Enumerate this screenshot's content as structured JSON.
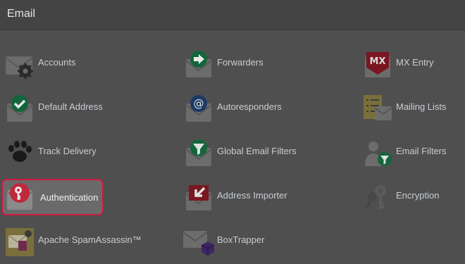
{
  "panel": {
    "title": "Email"
  },
  "items": [
    {
      "label": "Accounts",
      "icon": "envelope-gear-icon"
    },
    {
      "label": "Forwarders",
      "icon": "envelope-arrow-icon"
    },
    {
      "label": "MX Entry",
      "icon": "mx-envelope-icon"
    },
    {
      "label": "Default Address",
      "icon": "envelope-check-icon"
    },
    {
      "label": "Autoresponders",
      "icon": "envelope-at-icon"
    },
    {
      "label": "Mailing Lists",
      "icon": "mailing-list-icon"
    },
    {
      "label": "Track Delivery",
      "icon": "paw-icon"
    },
    {
      "label": "Global Email Filters",
      "icon": "envelope-funnel-icon"
    },
    {
      "label": "Email Filters",
      "icon": "person-funnel-icon"
    },
    {
      "label": "Authentication",
      "icon": "envelope-key-icon",
      "selected": true
    },
    {
      "label": "Address Importer",
      "icon": "envelope-import-icon"
    },
    {
      "label": "Encryption",
      "icon": "keys-icon"
    },
    {
      "label": "Apache SpamAssassin™",
      "icon": "spamassassin-icon"
    },
    {
      "label": "BoxTrapper",
      "icon": "envelope-box-icon"
    }
  ],
  "colors": {
    "highlight_border": "#d0193f",
    "link_text": "#c8cdd2"
  }
}
